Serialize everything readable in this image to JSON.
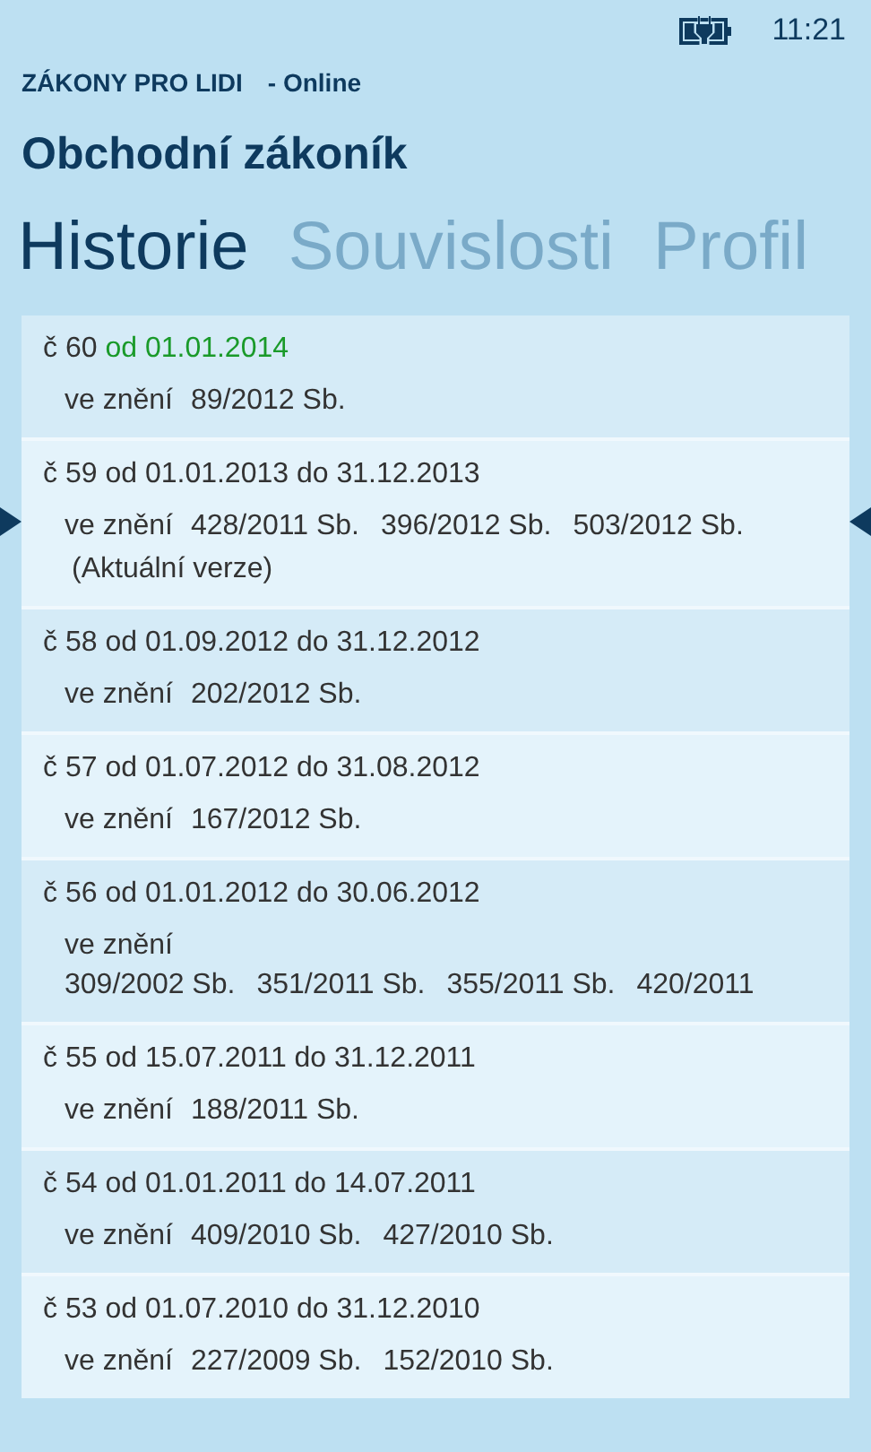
{
  "status_bar": {
    "time": "11:21"
  },
  "app_header": {
    "app_name": "ZÁKONY PRO LIDI",
    "mode": "- Online"
  },
  "page_title": "Obchodní zákoník",
  "tabs": [
    {
      "label": "Historie",
      "selected": true
    },
    {
      "label": "Souvislosti",
      "selected": false
    },
    {
      "label": "Profil",
      "selected": false
    }
  ],
  "versions": [
    {
      "number": "č 60",
      "period": "od 01.01.2014",
      "current": true,
      "selected": false,
      "label": "ve znění",
      "amendments": [
        "89/2012 Sb."
      ]
    },
    {
      "number": "č 59",
      "period": "od 01.01.2013 do 31.12.2013",
      "current": false,
      "selected": true,
      "label": "ve znění",
      "amendments": [
        "428/2011 Sb.",
        "396/2012 Sb.",
        "503/2012 Sb."
      ],
      "note": "(Aktuální verze)"
    },
    {
      "number": "č 58",
      "period": "od 01.09.2012 do 31.12.2012",
      "current": false,
      "selected": false,
      "label": "ve znění",
      "amendments": [
        "202/2012 Sb."
      ]
    },
    {
      "number": "č 57",
      "period": "od 01.07.2012 do 31.08.2012",
      "current": false,
      "selected": false,
      "label": "ve znění",
      "amendments": [
        "167/2012 Sb."
      ]
    },
    {
      "number": "č 56",
      "period": "od 01.01.2012 do 30.06.2012",
      "current": false,
      "selected": false,
      "label": "ve znění",
      "amendments": [
        "309/2002 Sb.",
        "351/2011 Sb.",
        "355/2011 Sb.",
        "420/2011"
      ]
    },
    {
      "number": "č 55",
      "period": "od 15.07.2011 do 31.12.2011",
      "current": false,
      "selected": false,
      "label": "ve znění",
      "amendments": [
        "188/2011 Sb."
      ]
    },
    {
      "number": "č 54",
      "period": "od 01.01.2011 do 14.07.2011",
      "current": false,
      "selected": false,
      "label": "ve znění",
      "amendments": [
        "409/2010 Sb.",
        "427/2010 Sb."
      ]
    },
    {
      "number": "č 53",
      "period": "od 01.07.2010 do 31.12.2010",
      "current": false,
      "selected": false,
      "label": "ve znění",
      "amendments": [
        "227/2009 Sb.",
        "152/2010 Sb."
      ]
    }
  ]
}
